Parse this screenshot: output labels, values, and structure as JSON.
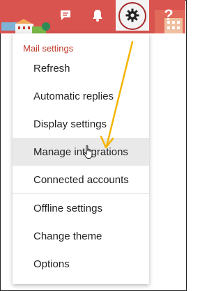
{
  "toolbar": {
    "chat_icon": "chat-bubble-icon",
    "bell_icon": "bell-icon",
    "gear_icon": "gear-icon",
    "help_label": "?"
  },
  "menu": {
    "section_title": "Mail settings",
    "items": [
      {
        "label": "Refresh"
      },
      {
        "label": "Automatic replies"
      },
      {
        "label": "Display settings"
      },
      {
        "label": "Manage integrations"
      },
      {
        "label": "Connected accounts"
      },
      {
        "label": "Offline settings"
      },
      {
        "label": "Change theme"
      },
      {
        "label": "Options"
      }
    ],
    "highlighted_item": "Manage integrations"
  },
  "colors": {
    "banner": "#d9534f",
    "section_title": "#c0392b",
    "annotation_circle": "#a62a2a",
    "annotation_arrow": "#f4b400",
    "hover": "#e9e9e9"
  }
}
